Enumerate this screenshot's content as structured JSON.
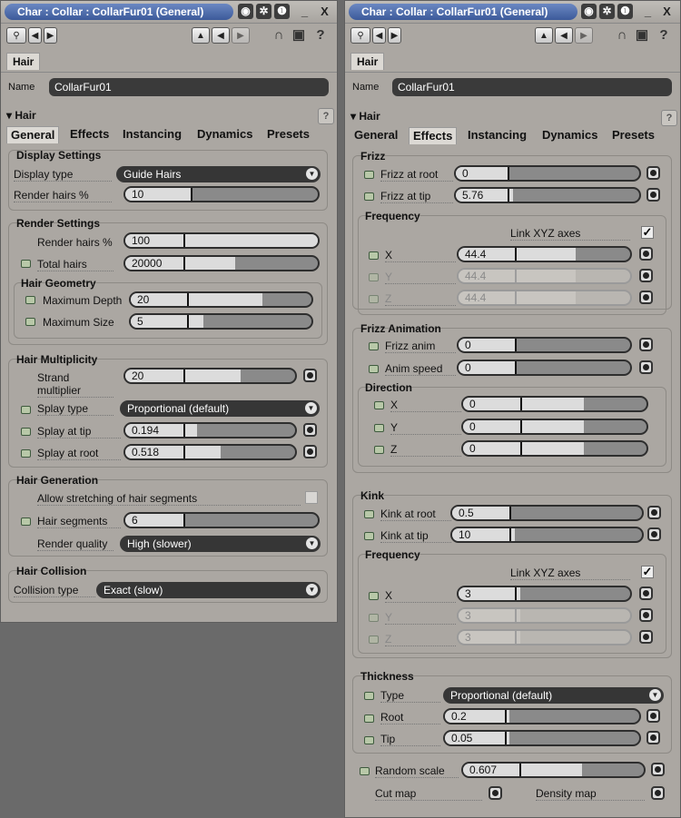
{
  "windows": [
    {
      "title": "Char : Collar : CollarFur01 (General)"
    },
    {
      "title": "Char : Collar : CollarFur01 (General)"
    }
  ],
  "hair_tab": "Hair",
  "name_label": "Name",
  "name_value": "CollarFur01",
  "hair_section": "Hair",
  "help": "?",
  "close": "X",
  "minimize": "_",
  "tabs": [
    "General",
    "Effects",
    "Instancing",
    "Dynamics",
    "Presets"
  ],
  "general": {
    "display": {
      "title": "Display Settings",
      "type_label": "Display type",
      "type_value": "Guide Hairs",
      "render_label": "Render hairs %",
      "render_value": "10"
    },
    "render": {
      "title": "Render Settings",
      "render_label": "Render hairs %",
      "render_value": "100",
      "total_label": "Total hairs",
      "total_value": "20000"
    },
    "geometry": {
      "title": "Hair Geometry",
      "depth_label": "Maximum Depth",
      "depth_value": "20",
      "size_label": "Maximum Size",
      "size_value": "5"
    },
    "multiplicity": {
      "title": "Hair Multiplicity",
      "strand_label_1": "Strand",
      "strand_label_2": "multiplier",
      "strand_value": "20",
      "splay_type_label": "Splay type",
      "splay_type_value": "Proportional (default)",
      "splay_tip_label": "Splay at tip",
      "splay_tip_value": "0.194",
      "splay_root_label": "Splay at root",
      "splay_root_value": "0.518"
    },
    "generation": {
      "title": "Hair Generation",
      "allow_label": "Allow stretching of hair segments",
      "segments_label": "Hair segments",
      "segments_value": "6",
      "quality_label": "Render quality",
      "quality_value": "High (slower)"
    },
    "collision": {
      "title": "Hair Collision",
      "type_label": "Collision type",
      "type_value": "Exact (slow)"
    }
  },
  "effects": {
    "frizz": {
      "title": "Frizz",
      "root_label": "Frizz at root",
      "root_value": "0",
      "tip_label": "Frizz at tip",
      "tip_value": "5.76"
    },
    "frizz_freq": {
      "title": "Frequency",
      "link_label": "Link XYZ axes",
      "x_label": "X",
      "x_value": "44.4",
      "y_label": "Y",
      "y_value": "44.4",
      "z_label": "Z",
      "z_value": "44.4"
    },
    "frizz_anim": {
      "title": "Frizz Animation",
      "anim_label": "Frizz anim",
      "anim_value": "0",
      "speed_label": "Anim speed",
      "speed_value": "0"
    },
    "direction": {
      "title": "Direction",
      "x_label": "X",
      "x_value": "0",
      "y_label": "Y",
      "y_value": "0",
      "z_label": "Z",
      "z_value": "0"
    },
    "kink": {
      "title": "Kink",
      "root_label": "Kink at root",
      "root_value": "0.5",
      "tip_label": "Kink at tip",
      "tip_value": "10"
    },
    "kink_freq": {
      "title": "Frequency",
      "link_label": "Link XYZ axes",
      "x_label": "X",
      "x_value": "3",
      "y_label": "Y",
      "y_value": "3",
      "z_label": "Z",
      "z_value": "3"
    },
    "thickness": {
      "title": "Thickness",
      "type_label": "Type",
      "type_value": "Proportional (default)",
      "root_label": "Root",
      "root_value": "0.2",
      "tip_label": "Tip",
      "tip_value": "0.05"
    },
    "random_label": "Random scale",
    "random_value": "0.607",
    "cut_label": "Cut map",
    "density_label": "Density map"
  }
}
